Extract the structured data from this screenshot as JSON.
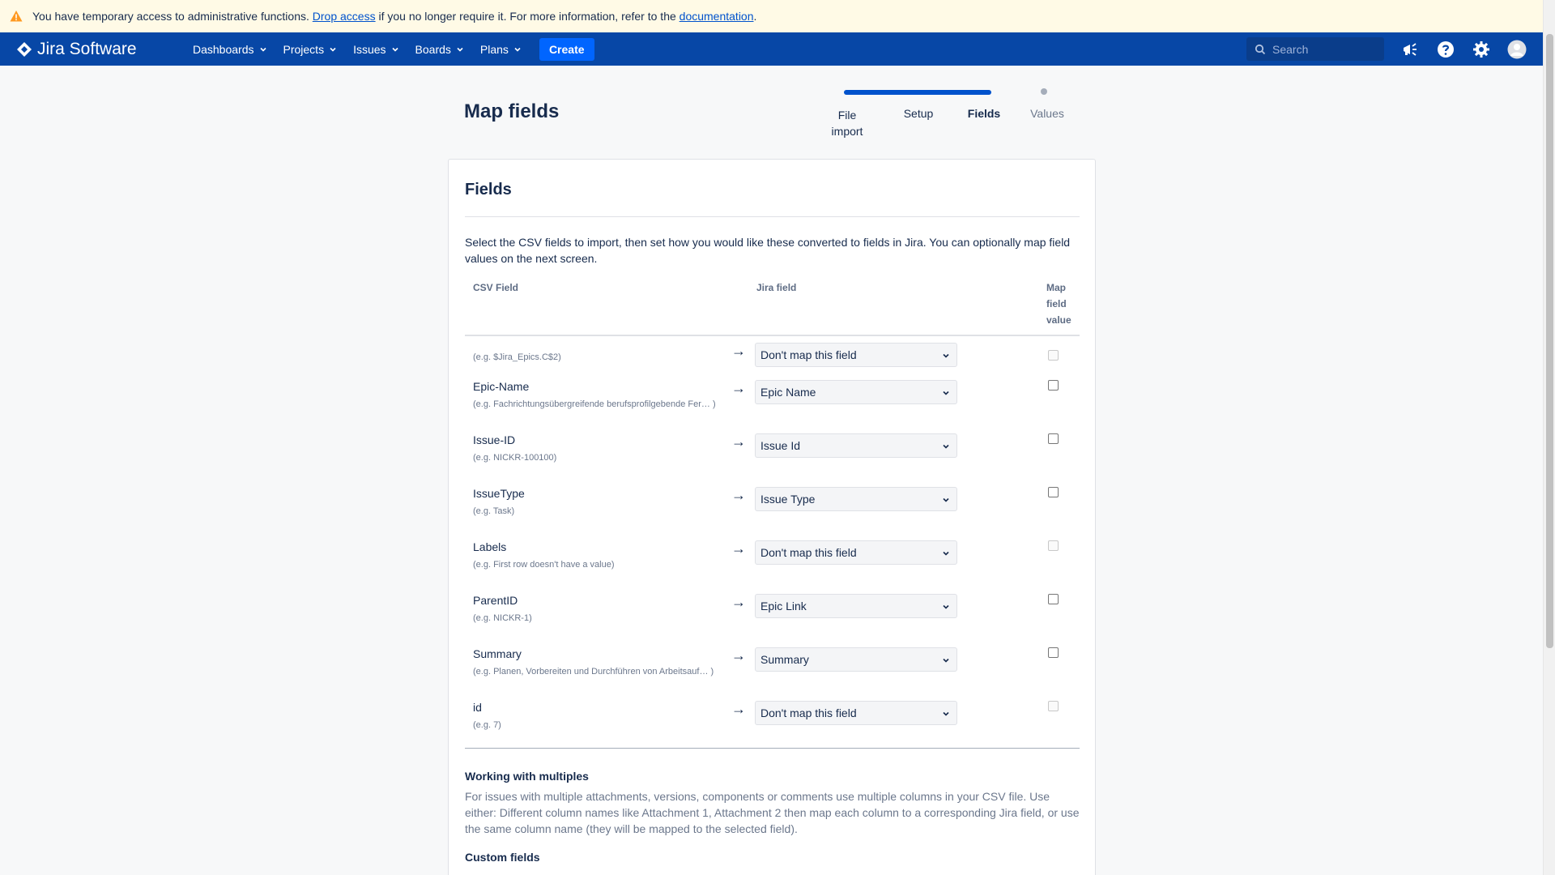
{
  "banner": {
    "text_before": "You have temporary access to administrative functions.",
    "drop_link": "Drop access",
    "text_middle": "if you no longer require it. For more information, refer to the",
    "doc_link": "documentation",
    "text_after": "."
  },
  "nav": {
    "logo": "Jira Software",
    "items": [
      {
        "label": "Dashboards"
      },
      {
        "label": "Projects"
      },
      {
        "label": "Issues"
      },
      {
        "label": "Boards"
      },
      {
        "label": "Plans"
      }
    ],
    "create_label": "Create",
    "search_placeholder": "Search"
  },
  "page": {
    "title": "Map fields"
  },
  "tracker": {
    "steps": [
      {
        "label": "File import",
        "state": "complete"
      },
      {
        "label": "Setup",
        "state": "complete"
      },
      {
        "label": "Fields",
        "state": "current"
      },
      {
        "label": "Values",
        "state": "future"
      }
    ]
  },
  "panel": {
    "title": "Fields",
    "intro": "Select the CSV fields to import, then set how you would like these converted to fields in Jira. You can optionally map field values on the next screen.",
    "columns": {
      "csv": "CSV Field",
      "jira": "Jira field",
      "map": "Map field value"
    },
    "rows": [
      {
        "name": "",
        "example": "(e.g.  $Jira_Epics.C$2)",
        "jira_field": "Don't map this field",
        "checkbox_enabled": false
      },
      {
        "name": "Epic-Name",
        "example": "(e.g.  Fachrichtungsübergreifende berufsprofilgebende Fer… )",
        "jira_field": "Epic Name",
        "checkbox_enabled": true
      },
      {
        "name": "Issue-ID",
        "example": "(e.g.  NICKR-100100)",
        "jira_field": "Issue Id",
        "checkbox_enabled": true
      },
      {
        "name": "IssueType",
        "example": "(e.g.  Task)",
        "jira_field": "Issue Type",
        "checkbox_enabled": true
      },
      {
        "name": "Labels",
        "example": "(e.g.  First row doesn't have a value)",
        "jira_field": "Don't map this field",
        "checkbox_enabled": false
      },
      {
        "name": "ParentID",
        "example": "(e.g.  NICKR-1)",
        "jira_field": "Epic Link",
        "checkbox_enabled": true
      },
      {
        "name": "Summary",
        "example": "(e.g.  Planen, Vorbereiten und Durchführen von Arbeitsauf… )",
        "jira_field": "Summary",
        "checkbox_enabled": true
      },
      {
        "name": "id",
        "example": "(e.g.  7)",
        "jira_field": "Don't map this field",
        "checkbox_enabled": false
      }
    ],
    "arrow": "→",
    "multiples_heading": "Working with multiples",
    "multiples_text": "For issues with multiple attachments, versions, components or comments use multiple columns in your CSV file. Use either: Different column names like Attachment 1, Attachment 2 then map each column to a corresponding Jira field, or use the same column name (they will be mapped to the selected field).",
    "custom_heading": "Custom fields"
  },
  "colors": {
    "nav_bg": "#0747a6",
    "banner_bg": "#fffae6",
    "accent": "#0052cc",
    "create_bg": "#0065ff"
  }
}
